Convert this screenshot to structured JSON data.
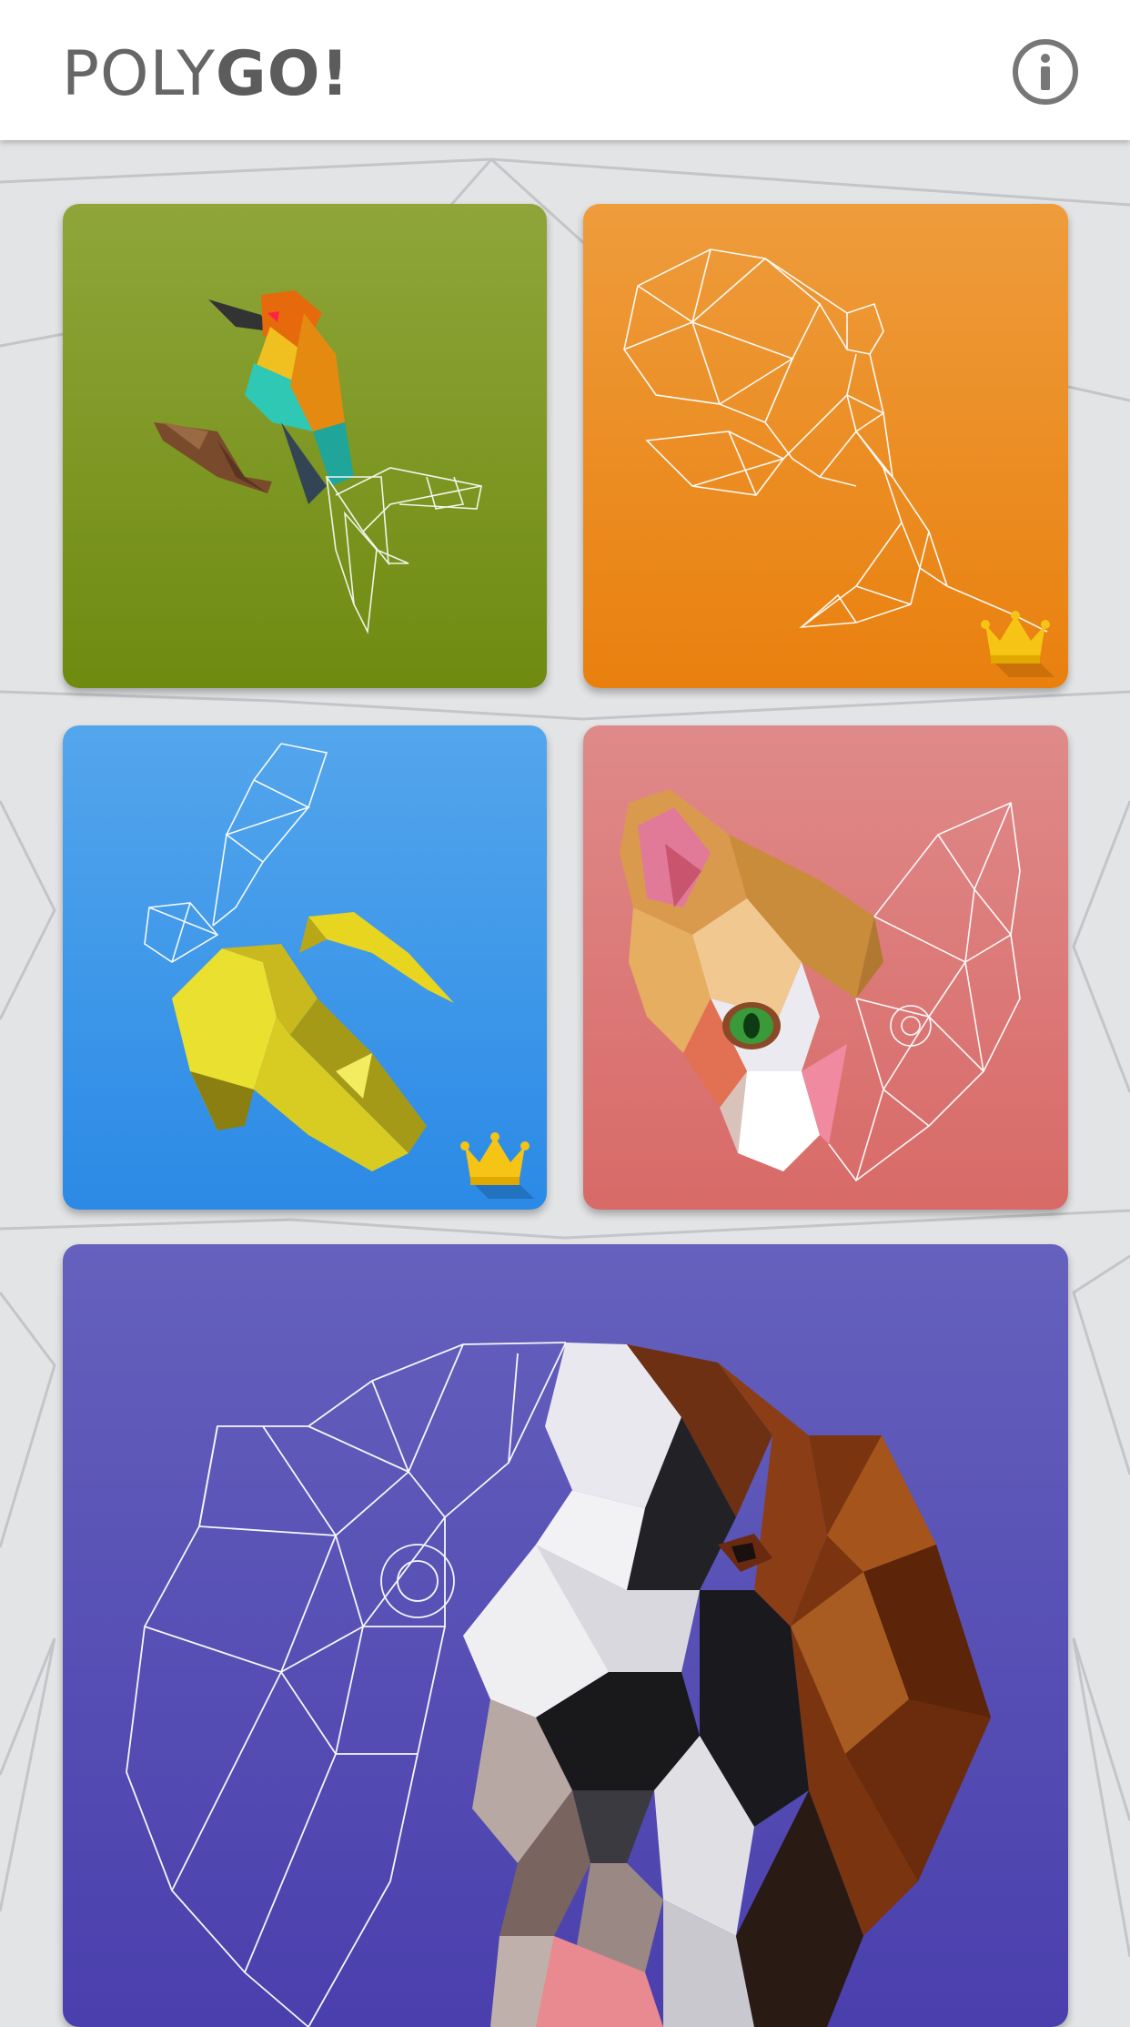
{
  "app": {
    "logo_light": "POLY",
    "logo_bold": "GO!"
  },
  "header": {
    "info_icon": "info-circle-icon"
  },
  "colors": {
    "header_bg": "#ffffff",
    "page_bg": "#e3e4e6",
    "logo_text": "#666666",
    "bird_tile": "#7d9822",
    "fairy_tile": "#ec8e22",
    "banana_tile": "#3a96e8",
    "cat_tile": "#dc7a78",
    "dog_tile": "#5750b5",
    "crown": "#f5c414"
  },
  "puzzles": [
    {
      "subject": "bird",
      "premium": false,
      "started": true
    },
    {
      "subject": "fairy",
      "premium": true,
      "started": false
    },
    {
      "subject": "banana",
      "premium": true,
      "started": true
    },
    {
      "subject": "cat",
      "premium": false,
      "started": true
    },
    {
      "subject": "dog",
      "premium": false,
      "started": true
    }
  ]
}
